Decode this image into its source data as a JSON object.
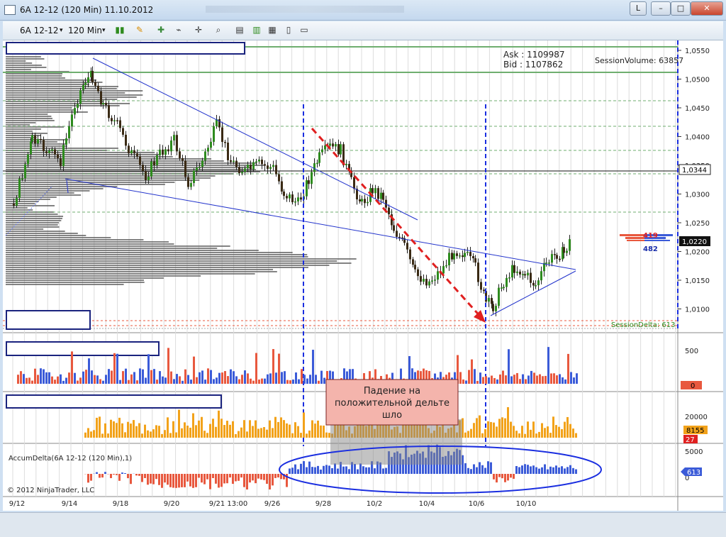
{
  "window": {
    "title": "6A 12-12 (120 Min)  11.10.2012",
    "btn_l": "L",
    "btn_min": "–",
    "btn_max": "□",
    "btn_close": "✕"
  },
  "toolbar": {
    "instrument": "6A 12-12",
    "interval": "120 Min",
    "dropdown_arrow": "▾",
    "icons": [
      "bar-type-icon",
      "pencil-icon",
      "add-indicator-icon",
      "strategy-icon",
      "crosshair-icon",
      "zoom-icon",
      "data-box-icon",
      "chart-trader-icon",
      "properties-icon",
      "template-icon"
    ]
  },
  "price_panel": {
    "ask_label": "Ask : 1109987",
    "bid_label": "Bid : 1107862",
    "session_volume": "SessionVolume: 63857",
    "session_delta": "SessionDelta: 613",
    "price_marker_1": "1,0344",
    "price_marker_2": "1,0220",
    "profile_value_1": "419",
    "profile_value_2": "482",
    "y_ticks": [
      "1,0550",
      "1,0500",
      "1,0450",
      "1,0400",
      "1,0350",
      "1,0300",
      "1,0250",
      "1,0200",
      "1,0150",
      "1,0100"
    ]
  },
  "annotation": {
    "line1": "Падение на",
    "line2": "положительной дельте",
    "line3": "шло"
  },
  "panel2": {
    "y_tick": "500",
    "marker": "0"
  },
  "panel3": {
    "y_tick": "20000",
    "marker_1": "8155",
    "marker_2": "27"
  },
  "panel4": {
    "label": "AccumDelta(6A 12-12 (120 Min),1)",
    "y_tick_top": "5000",
    "y_tick_mid": "0",
    "marker": "613",
    "copyright": "© 2012 NinjaTrader, LLC"
  },
  "x_axis": [
    "9/12",
    "9/14",
    "9/18",
    "9/20",
    "9/21 13:00",
    "9/26",
    "9/28",
    "10/2",
    "10/4",
    "10/6",
    "10/10"
  ],
  "colors": {
    "bull_candle": "#2e8b1e",
    "bear_candle": "#3a2a14",
    "trend_line": "#2233cc",
    "arrow": "#e02020",
    "vline": "#1a2ee0",
    "delta_up": "#3b5bd8",
    "delta_down": "#e8583e",
    "volume": "#f2a21a",
    "annotation_bg": "#f4b4ac"
  }
}
